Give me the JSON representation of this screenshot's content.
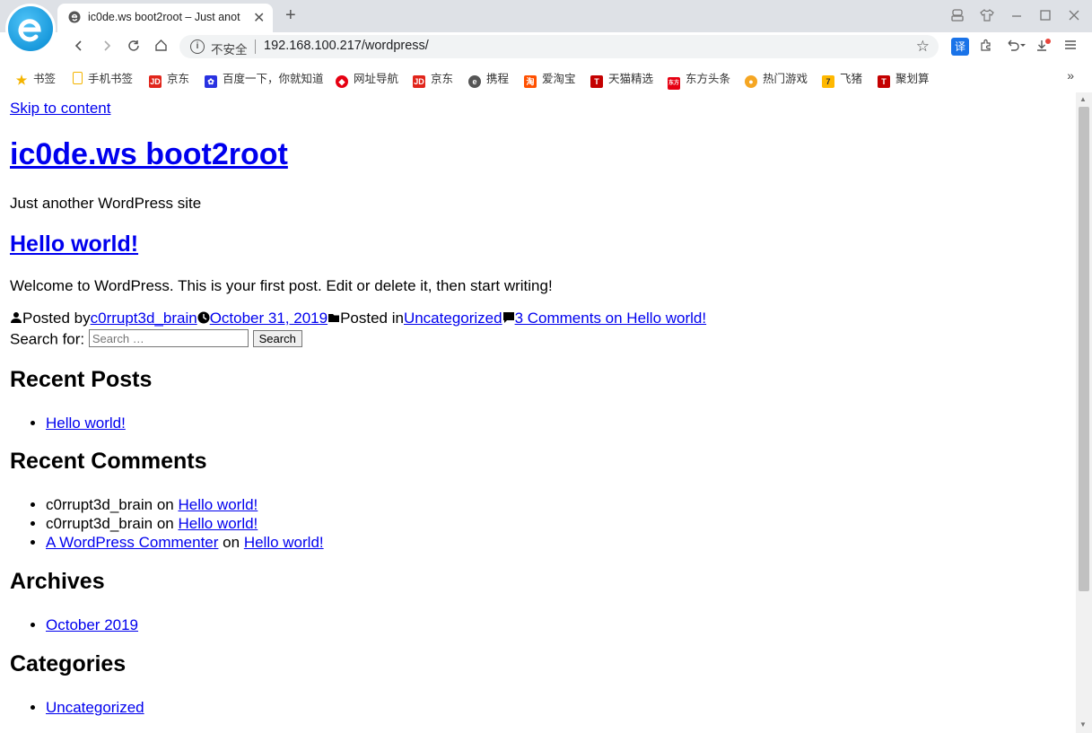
{
  "browser": {
    "tab_title": "ic0de.ws boot2root – Just anot",
    "new_tab": "+",
    "close": "✕",
    "insecure_label": "不安全",
    "url": "192.168.100.217/wordpress/",
    "translate_label": "译"
  },
  "bookmarks": [
    {
      "label": "书签",
      "icon": "star-icon",
      "color": "#f4b400"
    },
    {
      "label": "手机书签",
      "icon": "phone-icon",
      "color": "#f4b400"
    },
    {
      "label": "京东",
      "icon": "jd-icon",
      "color": "#e1251b"
    },
    {
      "label": "百度一下，你就知道",
      "icon": "baidu-paw-icon",
      "color": "#2932e1"
    },
    {
      "label": "网址导航",
      "icon": "nav-icon",
      "color": "#e60012"
    },
    {
      "label": "京东",
      "icon": "jd-icon",
      "color": "#e1251b"
    },
    {
      "label": "携程",
      "icon": "ctrip-icon",
      "color": "#555555"
    },
    {
      "label": "爱淘宝",
      "icon": "taobao-icon",
      "color": "#ff5000"
    },
    {
      "label": "天猫精选",
      "icon": "tmall-icon",
      "color": "#c40000"
    },
    {
      "label": "东方头条",
      "icon": "toutiao-icon",
      "color": "#e60012"
    },
    {
      "label": "热门游戏",
      "icon": "game-icon",
      "color": "#f5a623"
    },
    {
      "label": "飞猪",
      "icon": "fliggy-icon",
      "color": "#ffb800"
    },
    {
      "label": "聚划算",
      "icon": "juhuasuan-icon",
      "color": "#c40000"
    }
  ],
  "bookmarks_more": "»",
  "page": {
    "skip_link": "Skip to content",
    "site_title": "ic0de.ws boot2root",
    "tagline": "Just another WordPress site",
    "post": {
      "title": "Hello world!",
      "body": "Welcome to WordPress. This is your first post. Edit or delete it, then start writing!",
      "posted_by_label": "Posted by",
      "author": "c0rrupt3d_brain",
      "date": "October 31, 2019",
      "posted_in_label": "Posted in",
      "category": "Uncategorized",
      "comments_link": "3 Comments on Hello world!"
    },
    "search": {
      "label": "Search for:",
      "placeholder": "Search …",
      "button": "Search"
    },
    "recent_posts": {
      "heading": "Recent Posts",
      "items": [
        "Hello world!"
      ]
    },
    "recent_comments": {
      "heading": "Recent Comments",
      "items": [
        {
          "author": "c0rrupt3d_brain",
          "on": "on",
          "post": "Hello world!"
        },
        {
          "author": "c0rrupt3d_brain",
          "on": "on",
          "post": "Hello world!"
        },
        {
          "author": "A WordPress Commenter",
          "on": "on",
          "post": "Hello world!"
        }
      ]
    },
    "archives": {
      "heading": "Archives",
      "items": [
        "October 2019"
      ]
    },
    "categories": {
      "heading": "Categories",
      "items": [
        "Uncategorized"
      ]
    }
  }
}
